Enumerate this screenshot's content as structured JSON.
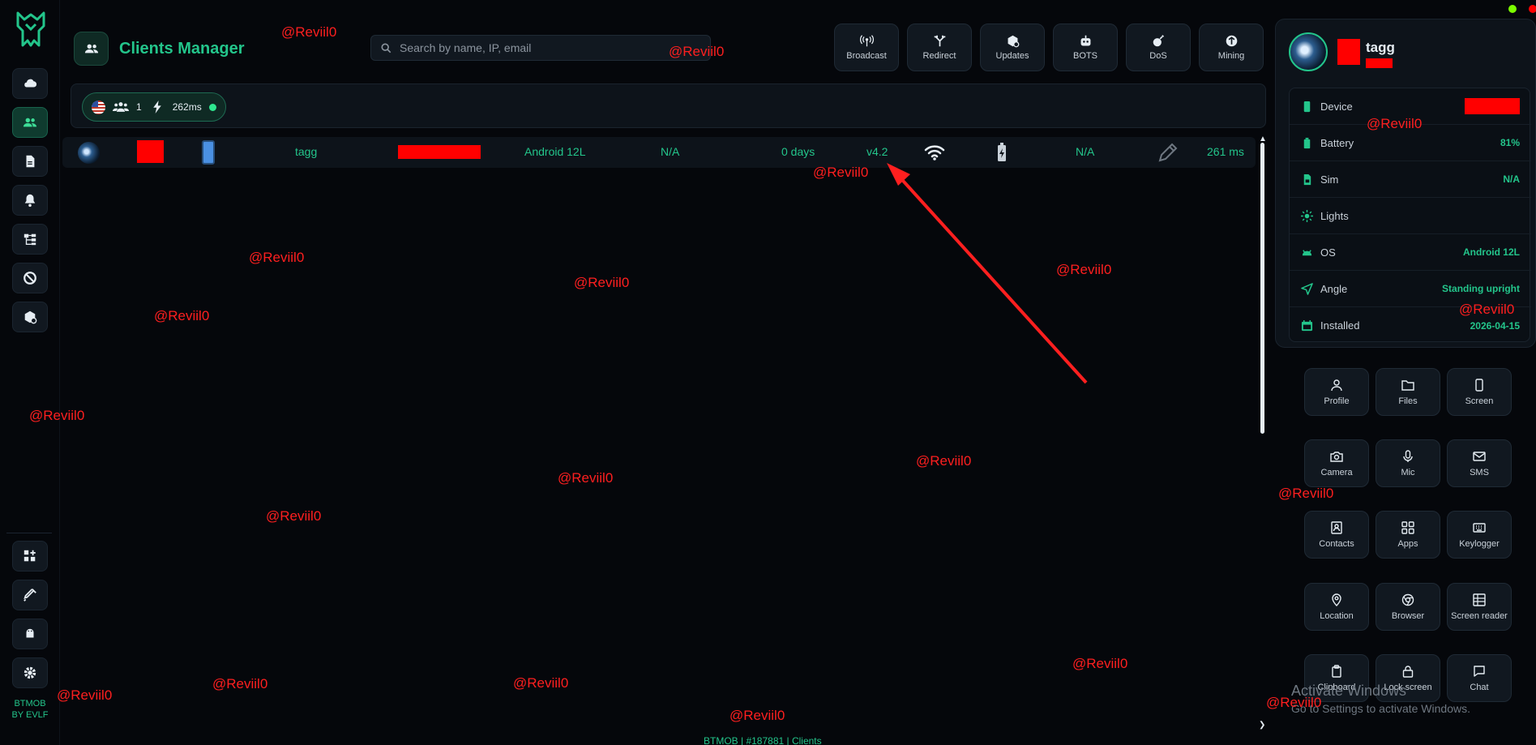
{
  "header": {
    "title": "Clients Manager"
  },
  "search": {
    "placeholder": "Search by name, IP, email"
  },
  "toolbar": [
    {
      "label": "Broadcast",
      "icon": "broadcast-icon"
    },
    {
      "label": "Redirect",
      "icon": "redirect-icon"
    },
    {
      "label": "Updates",
      "icon": "updates-icon"
    },
    {
      "label": "BOTS",
      "icon": "bot-icon"
    },
    {
      "label": "DoS",
      "icon": "bomb-icon"
    },
    {
      "label": "Mining",
      "icon": "mining-icon"
    }
  ],
  "stats": {
    "clients": "1",
    "latency": "262ms"
  },
  "client": {
    "name": "tagg",
    "os": "Android 12L",
    "country": "N/A",
    "uptime": "0 days",
    "version": "v4.2",
    "sim": "N/A",
    "ping": "261 ms"
  },
  "profile": {
    "name": "tagg",
    "info": [
      {
        "key": "Device",
        "value": "",
        "icon": "device-icon"
      },
      {
        "key": "Battery",
        "value": "81%",
        "icon": "battery-icon"
      },
      {
        "key": "Sim",
        "value": "N/A",
        "icon": "sim-icon"
      },
      {
        "key": "Lights",
        "value": "",
        "icon": "sun-icon"
      },
      {
        "key": "OS",
        "value": "Android 12L",
        "icon": "android-icon"
      },
      {
        "key": "Angle",
        "value": "Standing upright",
        "icon": "angle-icon"
      },
      {
        "key": "Installed",
        "value": "2026-04-15",
        "icon": "calendar-icon"
      }
    ]
  },
  "actions": [
    {
      "label": "Profile",
      "icon": "user-icon"
    },
    {
      "label": "Files",
      "icon": "folder-icon"
    },
    {
      "label": "Screen",
      "icon": "screen-icon"
    },
    {
      "label": "Camera",
      "icon": "camera-icon"
    },
    {
      "label": "Mic",
      "icon": "mic-icon"
    },
    {
      "label": "SMS",
      "icon": "sms-icon"
    },
    {
      "label": "Contacts",
      "icon": "contacts-icon"
    },
    {
      "label": "Apps",
      "icon": "apps-icon"
    },
    {
      "label": "Keylogger",
      "icon": "keyboard-icon"
    },
    {
      "label": "Location",
      "icon": "location-icon"
    },
    {
      "label": "Browser",
      "icon": "browser-icon"
    },
    {
      "label": "Screen reader",
      "icon": "screen-reader-icon"
    },
    {
      "label": "Clipboard",
      "icon": "clipboard-icon"
    },
    {
      "label": "Lock screen",
      "icon": "lock-icon"
    },
    {
      "label": "Chat",
      "icon": "chat-icon"
    }
  ],
  "brand": {
    "line1": "BTMOB",
    "line2": "BY EVLF"
  },
  "footer": {
    "text": "BTMOB | #187881 | Clients"
  },
  "windows": {
    "line1": "Activate Windows",
    "line2": "Go to Settings to activate Windows."
  },
  "watermark": "@Reviil0",
  "colors": {
    "accent": "#23c58b",
    "background": "#05070b",
    "panel": "#0d131a",
    "redaction": "#ff0000",
    "annotation": "#ff1f1f"
  }
}
